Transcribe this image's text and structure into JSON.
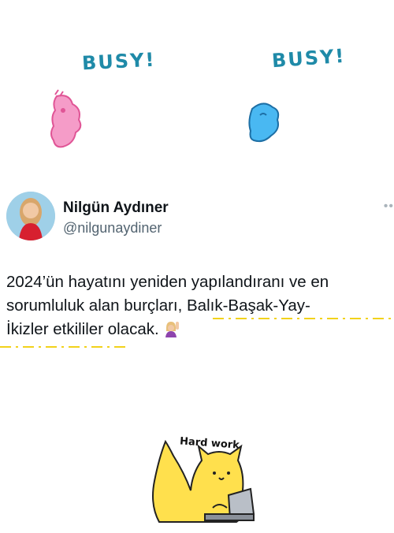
{
  "stickers": {
    "left_text": "BUSY!",
    "right_text": "BUSY!",
    "bottom_text": "Hard work"
  },
  "tweet": {
    "display_name": "Nilgün Aydıner",
    "handle": "@nilgunaydiner",
    "more_icon": "more-horizontal-icon",
    "lines": [
      "2024’ün hayatını yeniden yapılandıranı ve en",
      "sorumluluk alan burçları, Balık-Başak-Yay-",
      "İkizler etkililer olacak."
    ]
  },
  "colors": {
    "sticker_text": "#1f8aa8",
    "handle": "#536471",
    "highlight": "#f2d21b",
    "cat_fill": "#ffe04d"
  }
}
